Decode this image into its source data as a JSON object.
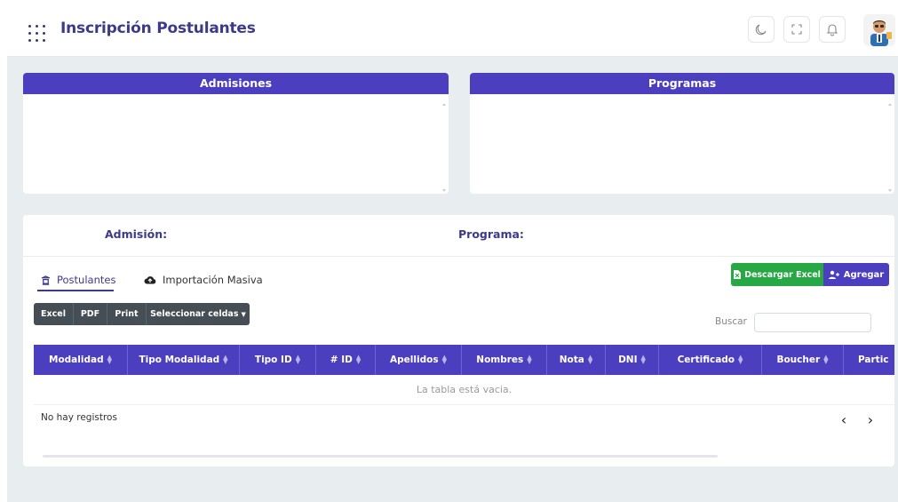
{
  "header": {
    "title": "Inscripción Postulantes",
    "icons": [
      "apps-grid-icon",
      "moon-icon",
      "fullscreen-icon",
      "bell-icon",
      "user-avatar"
    ]
  },
  "panels": {
    "admisiones": "Admisiones",
    "programas": "Programas"
  },
  "filters": {
    "admision_label": "Admisión:",
    "programa_label": "Programa:"
  },
  "tabs": [
    {
      "label": "Postulantes",
      "icon": "graduation-cap-icon",
      "active": true
    },
    {
      "label": "Importación Masiva",
      "icon": "cloud-upload-icon",
      "active": false
    }
  ],
  "actions": {
    "download_excel": "Descargar Excel",
    "add": "Agregar"
  },
  "export_buttons": {
    "excel": "Excel",
    "pdf": "PDF",
    "print": "Print",
    "select_cells": "Seleccionar celdas"
  },
  "search": {
    "label": "Buscar",
    "value": ""
  },
  "table": {
    "columns": [
      "Modalidad",
      "Tipo Modalidad",
      "Tipo ID",
      "# ID",
      "Apellidos",
      "Nombres",
      "Nota",
      "DNI",
      "Certificado",
      "Boucher",
      "Partic"
    ],
    "empty_message": "La tabla está vacia."
  },
  "footer": {
    "no_records": "No hay registros",
    "prev": "‹",
    "next": "›"
  },
  "colors": {
    "primary": "#4b3fbf",
    "title": "#3d3a8c",
    "success": "#28a745",
    "dark_button": "#454d55",
    "background": "#e8edef"
  }
}
